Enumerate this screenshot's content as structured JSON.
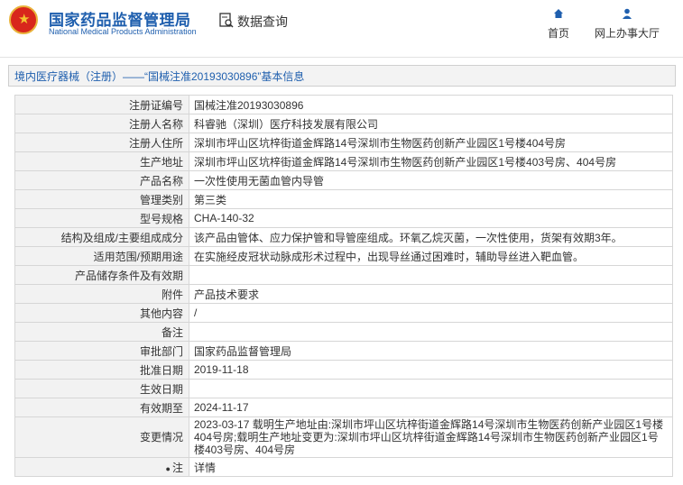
{
  "header": {
    "logo_cn": "国家药品监督管理局",
    "logo_en": "National Medical Products Administration",
    "query_label": "数据查询",
    "nav_home": "首页",
    "nav_office": "网上办事大厅"
  },
  "title": "境内医疗器械（注册）——“国械注准20193030896”基本信息",
  "rows": [
    {
      "label": "注册证编号",
      "value": "国械注准20193030896"
    },
    {
      "label": "注册人名称",
      "value": "科睿驰（深圳）医疗科技发展有限公司"
    },
    {
      "label": "注册人住所",
      "value": "深圳市坪山区坑梓街道金辉路14号深圳市生物医药创新产业园区1号楼404号房"
    },
    {
      "label": "生产地址",
      "value": "深圳市坪山区坑梓街道金辉路14号深圳市生物医药创新产业园区1号楼403号房、404号房"
    },
    {
      "label": "产品名称",
      "value": "一次性使用无菌血管内导管"
    },
    {
      "label": "管理类别",
      "value": "第三类"
    },
    {
      "label": "型号规格",
      "value": "CHA-140-32"
    },
    {
      "label": "结构及组成/主要组成成分",
      "value": "该产品由管体、应力保护管和导管座组成。环氧乙烷灭菌，一次性使用，货架有效期3年。"
    },
    {
      "label": "适用范围/预期用途",
      "value": "在实施经皮冠状动脉成形术过程中，出现导丝通过困难时，辅助导丝进入靶血管。"
    },
    {
      "label": "产品储存条件及有效期",
      "value": ""
    },
    {
      "label": "附件",
      "value": "产品技术要求"
    },
    {
      "label": "其他内容",
      "value": "/"
    },
    {
      "label": "备注",
      "value": ""
    },
    {
      "label": "审批部门",
      "value": "国家药品监督管理局"
    },
    {
      "label": "批准日期",
      "value": "2019-11-18"
    },
    {
      "label": "生效日期",
      "value": ""
    },
    {
      "label": "有效期至",
      "value": "2024-11-17"
    },
    {
      "label": "变更情况",
      "value": "2023-03-17 载明生产地址由:深圳市坪山区坑梓街道金辉路14号深圳市生物医药创新产业园区1号楼404号房;载明生产地址变更为:深圳市坪山区坑梓街道金辉路14号深圳市生物医药创新产业园区1号楼403号房、404号房"
    },
    {
      "label": "注",
      "value": "详情"
    }
  ],
  "icons": {
    "note": "lightbulb-icon",
    "home": "home-icon",
    "office": "user-icon",
    "query": "search-document-icon"
  },
  "colors": {
    "brand": "#1f5fae",
    "emblem": "#d8261c"
  }
}
